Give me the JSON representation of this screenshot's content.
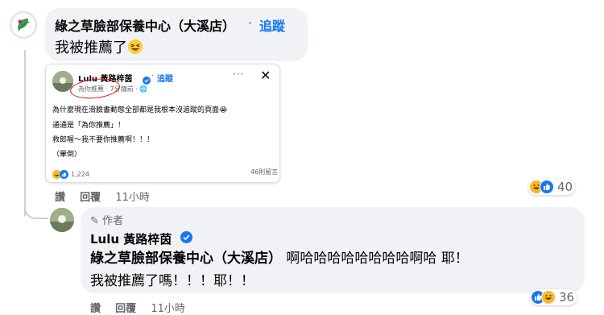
{
  "comment": {
    "author": "綠之草臉部保養中心（大溪店）",
    "separator": "·",
    "follow_label": "追蹤",
    "text": "我被推薦了",
    "actions": {
      "like": "讚",
      "reply": "回覆",
      "time": "11小時"
    },
    "reaction_count": "40",
    "reaction_icons": [
      "laugh-icon",
      "like-icon"
    ]
  },
  "screenshot": {
    "user": "Lulu 黃路梓茵",
    "separator": "·",
    "follow_label": "追蹤",
    "meta": "為你推薦 · 7分鐘前 · ",
    "more_label": "···",
    "close_label": "✕",
    "lines": [
      "為什麼現在滑臉書動態全部都是我根本沒追蹤的頁面😭",
      "通通是「為你推薦」！",
      "救郎喔～我不要你推薦啊！！！",
      "（暈倒）"
    ],
    "reaction_count": "1,224",
    "comment_count": "46則留言"
  },
  "reply": {
    "author_badge": "作者",
    "author": "Lulu 黃路梓茵",
    "mention": "綠之草臉部保養中心（大溪店）",
    "text_part1": " 啊哈哈哈哈哈哈哈哈啊哈 耶！",
    "text_part2": "我被推薦了嗎！！！耶！！",
    "actions": {
      "like": "讚",
      "reply": "回覆",
      "time": "11小時"
    },
    "reaction_count": "36",
    "reaction_icons": [
      "like-icon",
      "laugh-icon"
    ]
  },
  "colors": {
    "link": "#1877f2",
    "bubble": "#f0f2f5",
    "muted": "#65676b",
    "annotation": "#dd1111"
  }
}
